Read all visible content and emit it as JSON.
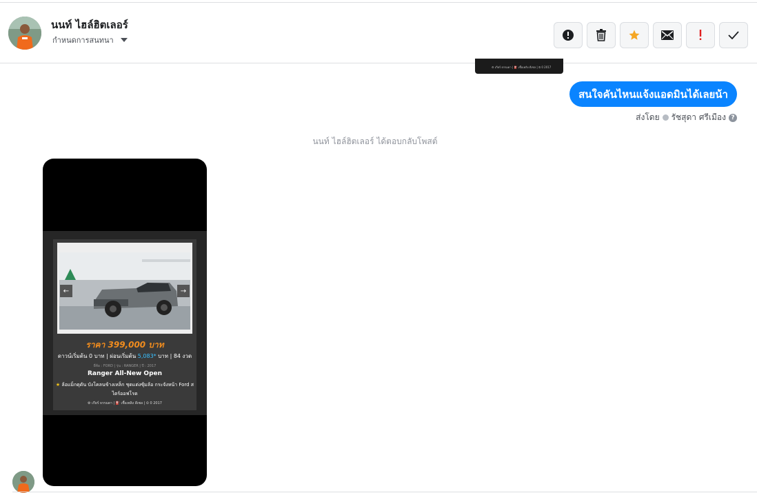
{
  "header": {
    "contact_name": "นนท์ ไฮล์ฮิตเลอร์",
    "assign_label": "กำหนดการสนทนา",
    "toolbar": [
      {
        "name": "spam-button",
        "icon": "alert-circle-icon"
      },
      {
        "name": "delete-button",
        "icon": "trash-icon"
      },
      {
        "name": "star-button",
        "icon": "star-icon"
      },
      {
        "name": "mark-unread-button",
        "icon": "envelope-icon"
      },
      {
        "name": "follow-up-button",
        "icon": "exclamation-icon"
      },
      {
        "name": "done-button",
        "icon": "check-icon"
      }
    ]
  },
  "conversation": {
    "outgoing_message": "สนใจคันไหนแจ้งแอดมินได้เลยน้า",
    "sent_by_prefix": "ส่งโดย",
    "sent_by_name": "รัชสุดา ศรีเมือง",
    "help_glyph": "?",
    "system_note": "นนท์ ไฮล์ฮิตเลอร์ ได้ตอบกลับโพสต์",
    "top_thumbnail_text": "⚙ เกียร์ ธรรมดา  |  ⛽ เชื้อเพลิง ดีเซล  |  ⏲ 0 2017"
  },
  "post_card": {
    "nav_prev": "←",
    "nav_next": "→",
    "price": "ราคา 399,000 บาท",
    "down_prefix": "ดาวน์เริ่มต้น 0 บาท | ผ่อนเริ่มต้น",
    "monthly": "5,083*",
    "down_suffix": "บาท | 84 งวด",
    "spec_line": "ยี่ห้อ : FORD | รุ่น : RANGER | ปี : 2017",
    "model": "Ranger All-New Open",
    "features_star": "★",
    "features": "ล้อแม็กดุดัน บังโคลนข้างเหล็ก ชุดแต่งซุ้มล้อ กระจังหน้า Ford สไตร์ออฟโรด",
    "footer": "⚙ เกียร์ ธรรมดา  |  ⛽ เชื้อเพลิง ดีเซล  |  ⏲ 0 2017"
  },
  "colors": {
    "bubble": "#0a84ff",
    "price": "#f08c1e",
    "star": "#f5a623",
    "flag": "#e02020"
  }
}
